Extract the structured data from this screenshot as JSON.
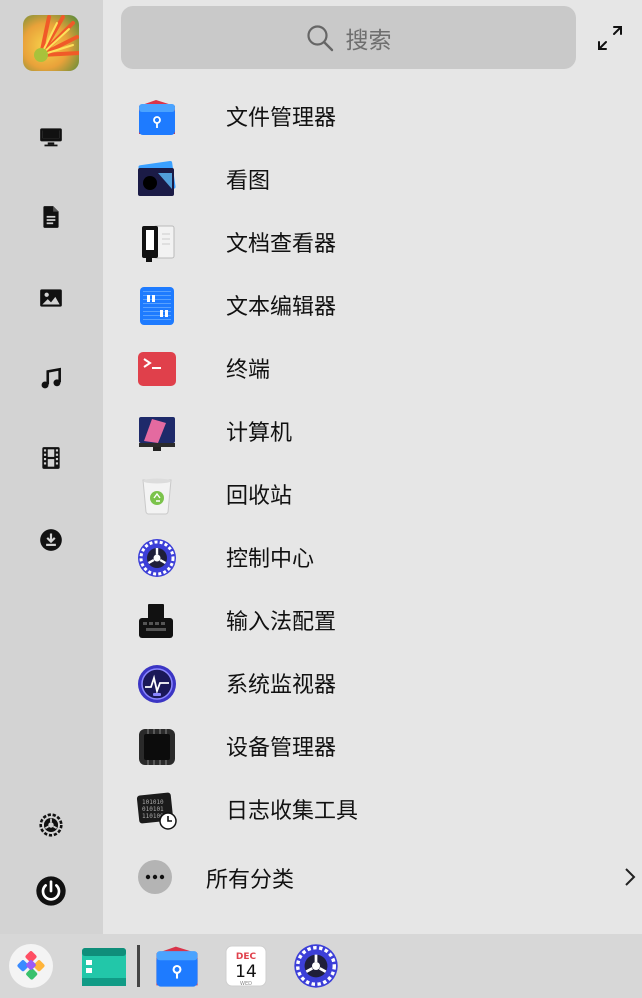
{
  "search": {
    "placeholder": "搜索"
  },
  "apps": [
    {
      "label": "文件管理器",
      "icon": "file-manager-icon"
    },
    {
      "label": "看图",
      "icon": "image-viewer-icon"
    },
    {
      "label": "文档查看器",
      "icon": "document-viewer-icon"
    },
    {
      "label": "文本编辑器",
      "icon": "text-editor-icon"
    },
    {
      "label": "终端",
      "icon": "terminal-icon"
    },
    {
      "label": "计算机",
      "icon": "computer-icon"
    },
    {
      "label": "回收站",
      "icon": "trash-icon"
    },
    {
      "label": "控制中心",
      "icon": "control-center-icon"
    },
    {
      "label": "输入法配置",
      "icon": "input-method-icon"
    },
    {
      "label": "系统监视器",
      "icon": "system-monitor-icon"
    },
    {
      "label": "设备管理器",
      "icon": "device-manager-icon"
    },
    {
      "label": "日志收集工具",
      "icon": "log-collector-icon"
    }
  ],
  "categories": {
    "label": "所有分类"
  },
  "sidebar": {
    "items": [
      "computer-icon",
      "document-icon",
      "picture-icon",
      "music-icon",
      "video-icon",
      "download-icon",
      "settings-icon",
      "power-icon"
    ]
  },
  "dock": {
    "calendar_month": "DEC",
    "calendar_day": "14",
    "calendar_weekday": "WED"
  },
  "colors": {
    "sidebar_bg": "#d3d3d3",
    "panel_bg": "#e6e6e6",
    "search_bg": "#c9c9c9",
    "dock_bg": "#d7d7d7",
    "accent_blue": "#1e7bff",
    "terminal_red": "#e0404b"
  }
}
